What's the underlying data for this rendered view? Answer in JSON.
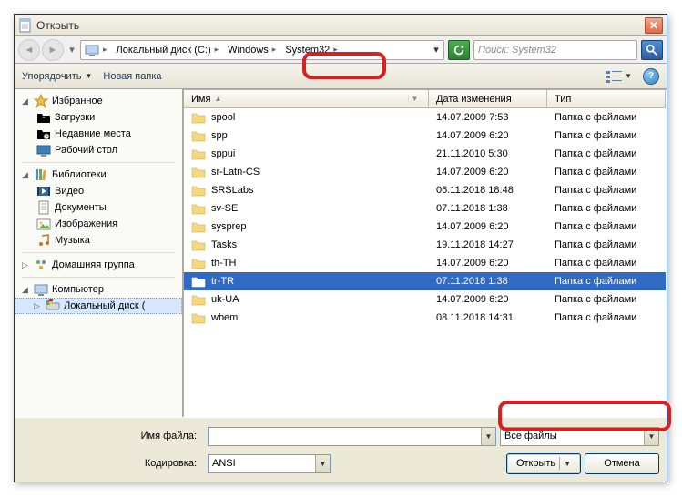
{
  "window": {
    "title": "Открыть"
  },
  "nav": {
    "crumbs": [
      {
        "label": "",
        "has_icon": true
      },
      {
        "label": "Локальный диск (C:)"
      },
      {
        "label": "Windows"
      },
      {
        "label": "System32"
      }
    ],
    "search_placeholder": "Поиск: System32"
  },
  "toolbar": {
    "organize": "Упорядочить",
    "new_folder": "Новая папка"
  },
  "sidebar": {
    "favorites": {
      "label": "Избранное",
      "items": [
        {
          "id": "downloads",
          "label": "Загрузки"
        },
        {
          "id": "recent",
          "label": "Недавние места"
        },
        {
          "id": "desktop",
          "label": "Рабочий стол"
        }
      ]
    },
    "libraries": {
      "label": "Библиотеки",
      "items": [
        {
          "id": "videos",
          "label": "Видео"
        },
        {
          "id": "documents",
          "label": "Документы"
        },
        {
          "id": "pictures",
          "label": "Изображения"
        },
        {
          "id": "music",
          "label": "Музыка"
        }
      ]
    },
    "homegroup": {
      "label": "Домашняя группа"
    },
    "computer": {
      "label": "Компьютер",
      "items": [
        {
          "id": "local-disk-c",
          "label": "Локальный диск ("
        }
      ]
    }
  },
  "columns": {
    "name": "Имя",
    "date": "Дата изменения",
    "type": "Тип"
  },
  "files": [
    {
      "name": "spool",
      "date": "14.07.2009 7:53",
      "type": "Папка с файлами",
      "sel": false
    },
    {
      "name": "spp",
      "date": "14.07.2009 6:20",
      "type": "Папка с файлами",
      "sel": false
    },
    {
      "name": "sppui",
      "date": "21.11.2010 5:30",
      "type": "Папка с файлами",
      "sel": false
    },
    {
      "name": "sr-Latn-CS",
      "date": "14.07.2009 6:20",
      "type": "Папка с файлами",
      "sel": false
    },
    {
      "name": "SRSLabs",
      "date": "06.11.2018 18:48",
      "type": "Папка с файлами",
      "sel": false
    },
    {
      "name": "sv-SE",
      "date": "07.11.2018 1:38",
      "type": "Папка с файлами",
      "sel": false
    },
    {
      "name": "sysprep",
      "date": "14.07.2009 6:20",
      "type": "Папка с файлами",
      "sel": false
    },
    {
      "name": "Tasks",
      "date": "19.11.2018 14:27",
      "type": "Папка с файлами",
      "sel": false
    },
    {
      "name": "th-TH",
      "date": "14.07.2009 6:20",
      "type": "Папка с файлами",
      "sel": false
    },
    {
      "name": "tr-TR",
      "date": "07.11.2018 1:38",
      "type": "Папка с файлами",
      "sel": true
    },
    {
      "name": "uk-UA",
      "date": "14.07.2009 6:20",
      "type": "Папка с файлами",
      "sel": false
    },
    {
      "name": "wbem",
      "date": "08.11.2018 14:31",
      "type": "Папка с файлами",
      "sel": false
    }
  ],
  "bottom": {
    "filename_label": "Имя файла:",
    "filename_value": "",
    "filter_value": "Все файлы",
    "encoding_label": "Кодировка:",
    "encoding_value": "ANSI",
    "open_btn": "Открыть",
    "cancel_btn": "Отмена"
  }
}
